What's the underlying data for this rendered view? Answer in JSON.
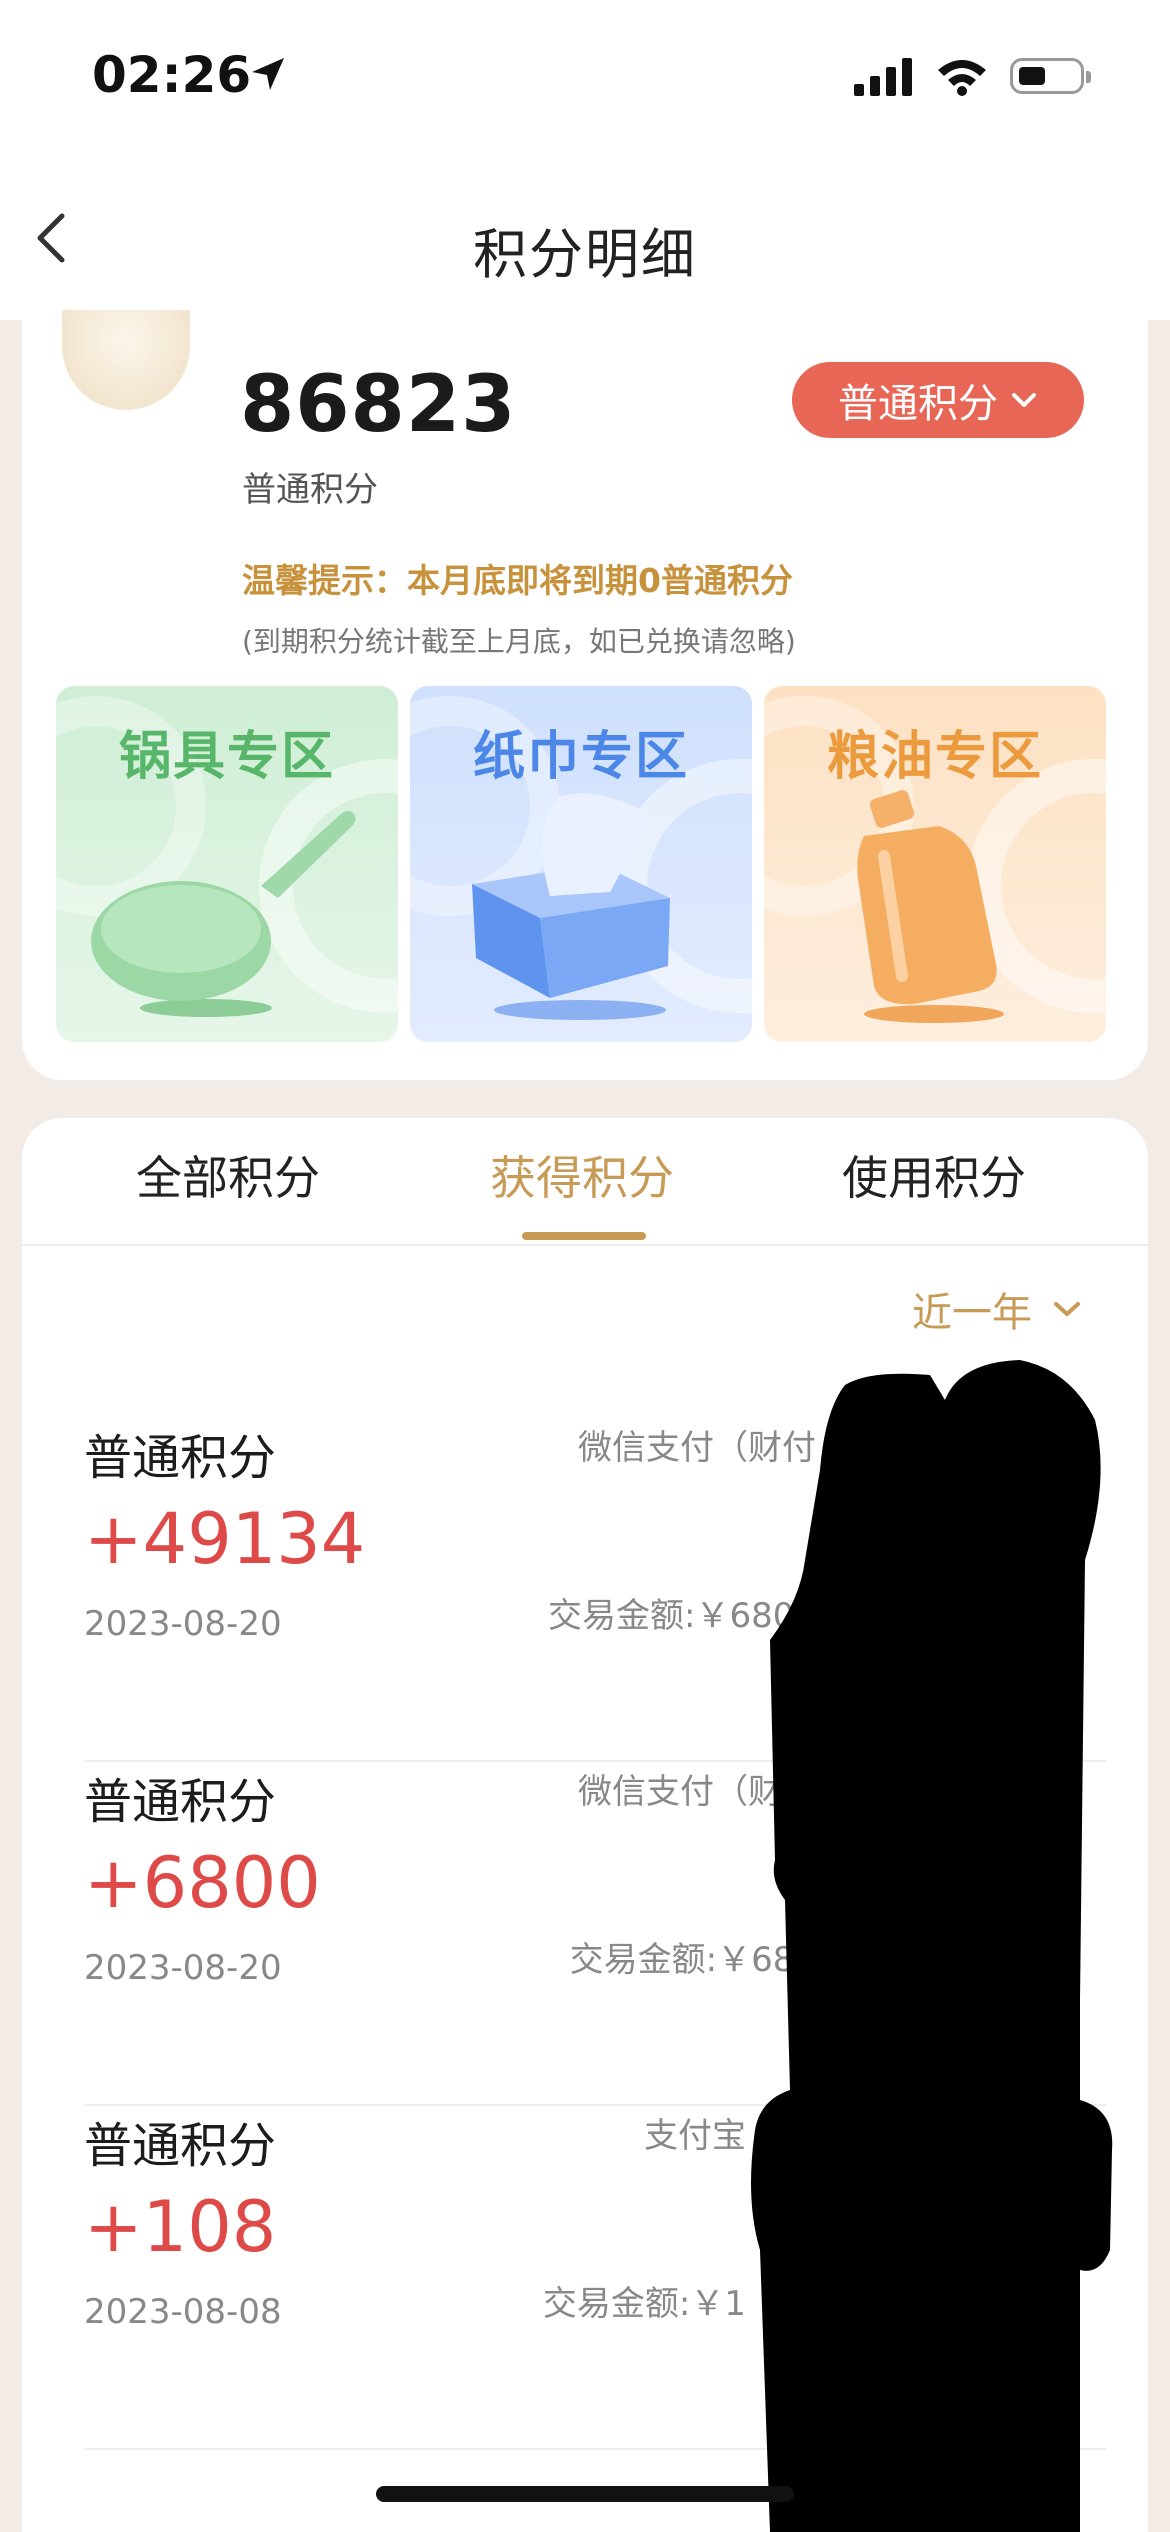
{
  "status_bar": {
    "time": "02:26"
  },
  "header": {
    "title": "积分明细"
  },
  "summary": {
    "points": "86823",
    "points_label": "普通积分",
    "type_selector": "普通积分",
    "tip": "温馨提示：本月底即将到期0普通积分",
    "tip_note": "(到期积分统计截至上月底，如已兑换请忽略)"
  },
  "zones": [
    {
      "title": "锅具专区",
      "icon": "pan-icon"
    },
    {
      "title": "纸巾专区",
      "icon": "tissue-box-icon"
    },
    {
      "title": "粮油专区",
      "icon": "oil-bottle-icon"
    }
  ],
  "tabs": [
    {
      "label": "全部积分",
      "active": false
    },
    {
      "label": "获得积分",
      "active": true
    },
    {
      "label": "使用积分",
      "active": false
    }
  ],
  "filter": {
    "label": "近一年"
  },
  "records": [
    {
      "title": "普通积分",
      "amount": "+49134",
      "date": "2023-08-20",
      "desc": "微信支付（财付",
      "trade": "交易金额:￥6800"
    },
    {
      "title": "普通积分",
      "amount": "+6800",
      "date": "2023-08-20",
      "desc": "微信支付（财付",
      "trade": "交易金额:￥680"
    },
    {
      "title": "普通积分",
      "amount": "+108",
      "date": "2023-08-08",
      "desc": "支付宝",
      "trade": "交易金额:￥1"
    }
  ],
  "colors": {
    "accent": "#c79a55",
    "amount": "#dd4a48",
    "type_button": "#e86656"
  }
}
